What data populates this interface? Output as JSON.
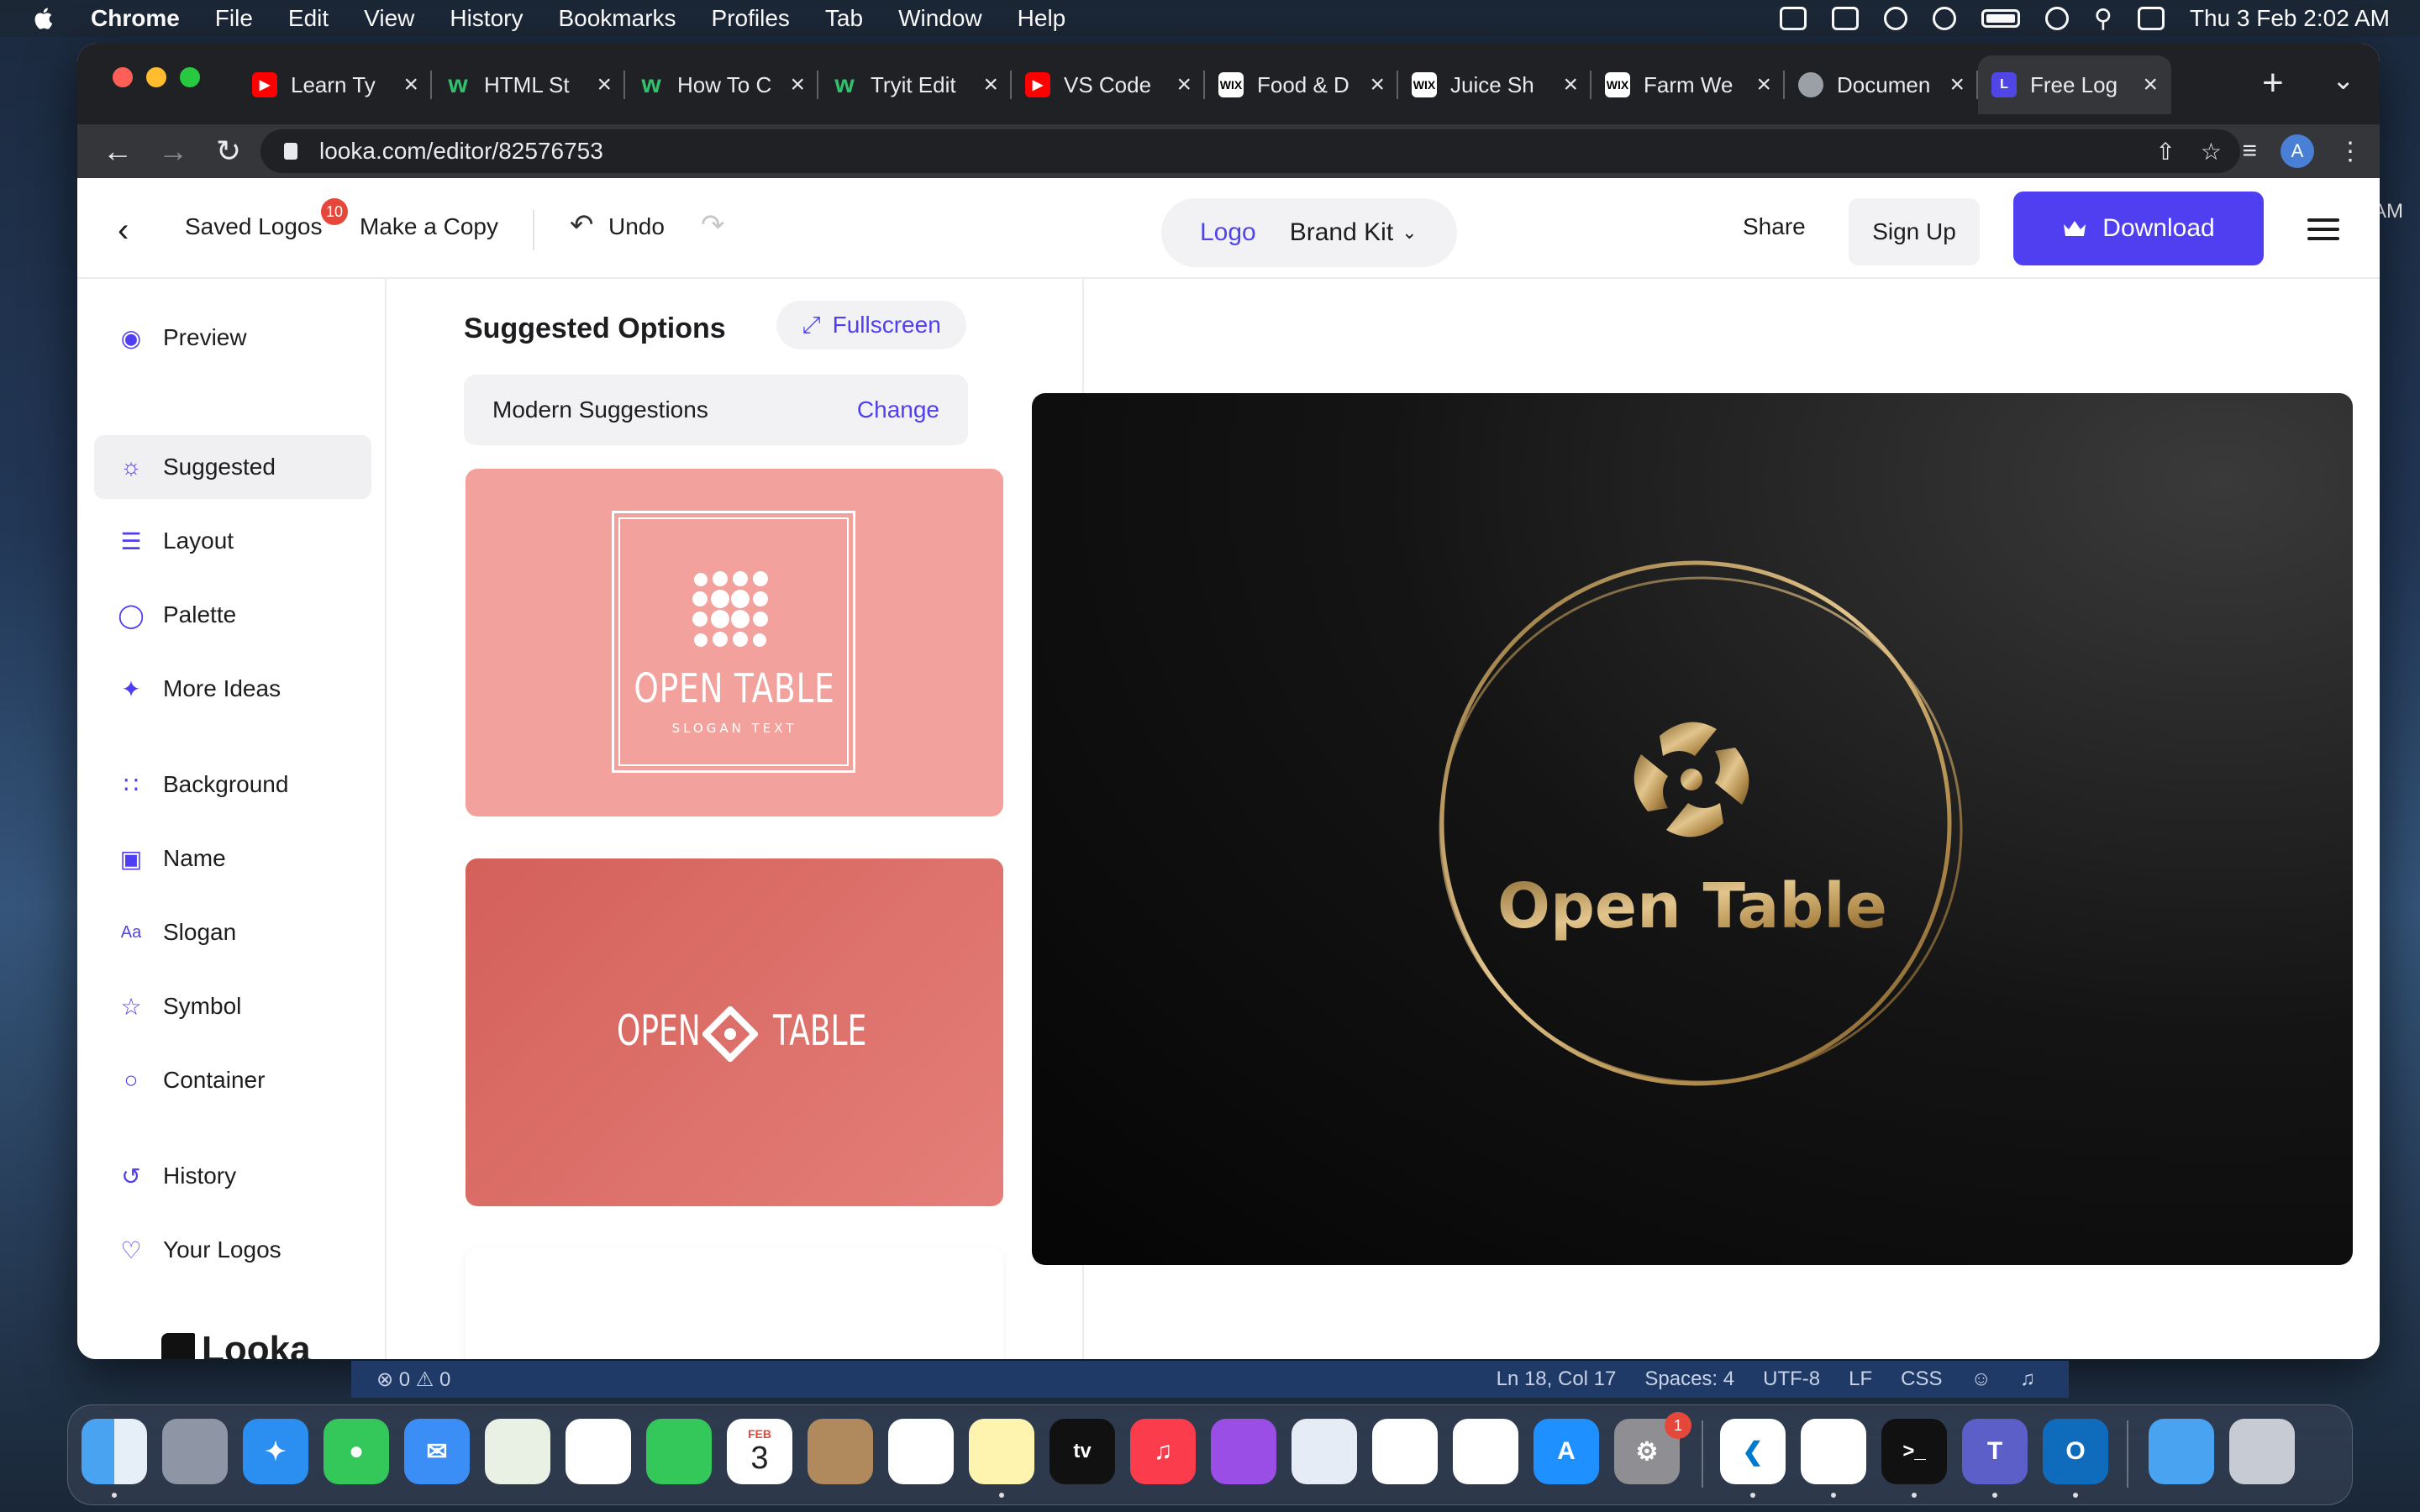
{
  "menubar": {
    "app": "Chrome",
    "items": [
      "File",
      "Edit",
      "View",
      "History",
      "Bookmarks",
      "Profiles",
      "Tab",
      "Window",
      "Help"
    ],
    "datetime": "Thu 3 Feb  2:02 AM"
  },
  "browser": {
    "tabs": [
      {
        "title": "Learn Ty",
        "favicon": "youtube-icon"
      },
      {
        "title": "HTML St",
        "favicon": "w-icon"
      },
      {
        "title": "How To C",
        "favicon": "w-icon"
      },
      {
        "title": "Tryit Edit",
        "favicon": "w-icon"
      },
      {
        "title": "VS Code",
        "favicon": "youtube-icon"
      },
      {
        "title": "Food & D",
        "favicon": "wix-icon"
      },
      {
        "title": "Juice Sh",
        "favicon": "wix-icon"
      },
      {
        "title": "Farm We",
        "favicon": "wix-icon"
      },
      {
        "title": "Documen",
        "favicon": "globe-icon"
      },
      {
        "title": "Free Log",
        "favicon": "looka-icon",
        "active": true
      }
    ],
    "url": "looka.com/editor/82576753",
    "profile_initial": "A"
  },
  "header": {
    "saved_logos": "Saved Logos",
    "saved_count": "10",
    "make_copy": "Make a Copy",
    "undo": "Undo",
    "tab_logo": "Logo",
    "tab_brand_kit": "Brand Kit",
    "share": "Share",
    "sign_up": "Sign Up",
    "download": "Download",
    "edge_text": "AM"
  },
  "sidebar": {
    "items": [
      {
        "label": "Preview",
        "icon": "eye-icon"
      },
      {
        "label": "Suggested",
        "icon": "lightbulb-icon",
        "active": true
      },
      {
        "label": "Layout",
        "icon": "layers-icon"
      },
      {
        "label": "Palette",
        "icon": "droplet-icon"
      },
      {
        "label": "More Ideas",
        "icon": "magic-wand-icon"
      },
      {
        "label": "Background",
        "icon": "grid-icon"
      },
      {
        "label": "Name",
        "icon": "text-box-icon"
      },
      {
        "label": "Slogan",
        "icon": "font-icon"
      },
      {
        "label": "Symbol",
        "icon": "star-icon"
      },
      {
        "label": "Container",
        "icon": "circle-icon"
      },
      {
        "label": "History",
        "icon": "history-icon"
      },
      {
        "label": "Your Logos",
        "icon": "heart-icon"
      }
    ],
    "brand": "Looka"
  },
  "panel": {
    "title": "Suggested Options",
    "fullscreen": "Fullscreen",
    "suggestion_set": "Modern Suggestions",
    "change": "Change",
    "card1": {
      "name": "OPEN TABLE",
      "slogan": "SLOGAN TEXT",
      "bg": "#f2a19c"
    },
    "card2": {
      "left": "OPEN",
      "right": "TABLE",
      "bg": "#d4605a"
    }
  },
  "preview": {
    "logo_name": "Open Table",
    "gold": "#c9a86a"
  },
  "vscode_status": {
    "problems": "⊗ 0 ⚠ 0",
    "position": "Ln 18, Col 17",
    "spaces": "Spaces: 4",
    "encoding": "UTF-8",
    "eol": "LF",
    "lang": "CSS"
  },
  "dock": {
    "calendar_month": "FEB",
    "calendar_day": "3",
    "settings_badge": "1",
    "tv_label": "tv",
    "teams_letter": "T",
    "outlook_letter": "O"
  },
  "colors": {
    "accent": "#4f3ff0",
    "badge": "#e5473a"
  }
}
